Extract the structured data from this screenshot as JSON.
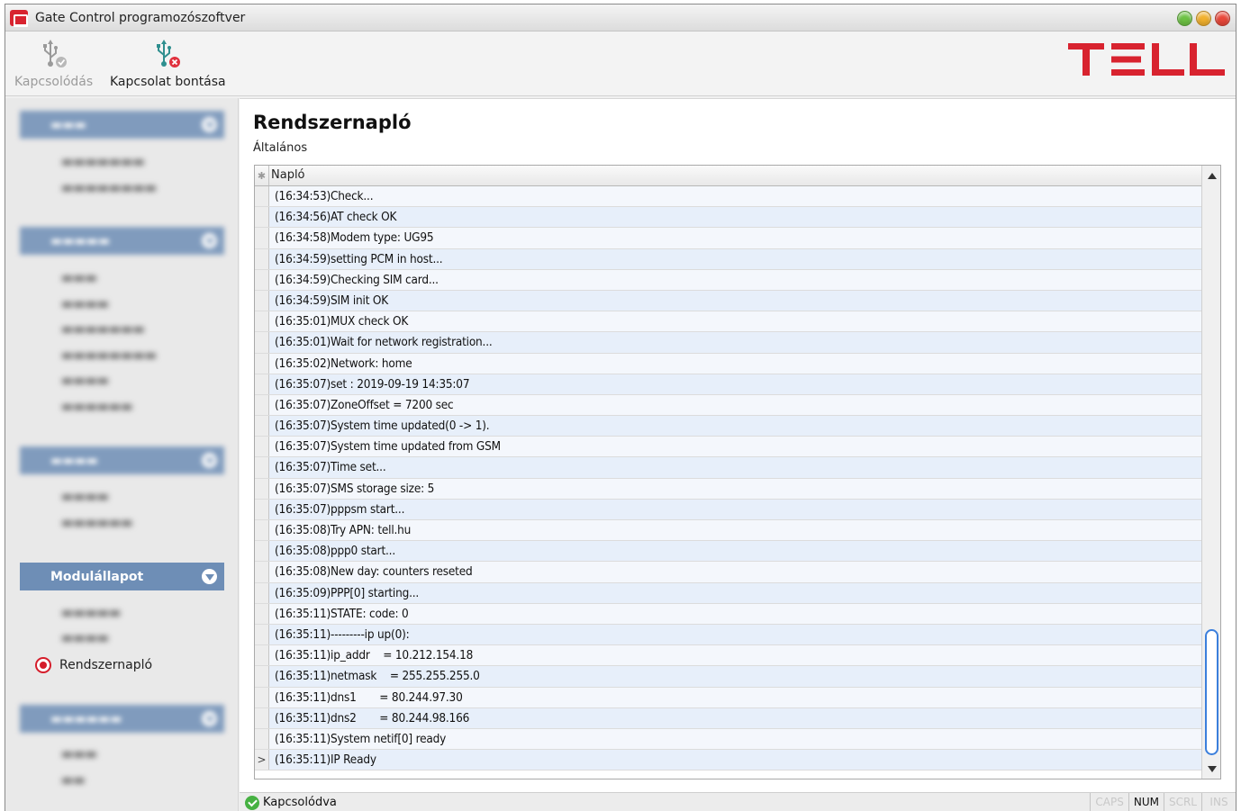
{
  "window": {
    "title": "Gate Control programozószoftver"
  },
  "toolbar": {
    "connect_label": "Kapcsolódás",
    "disconnect_label": "Kapcsolat bontása",
    "logo_text": "TELL",
    "logo_color": "#d8232f"
  },
  "sidebar": {
    "active_group": "Modulállapot",
    "active_item": "Rendszernapló",
    "accent_color": "#6e8eb6"
  },
  "main": {
    "title": "Rendszernapló",
    "section": "Általános",
    "column_header": "Napló",
    "log": [
      "(16:34:53)Check...",
      "(16:34:56)AT check OK",
      "(16:34:58)Modem type: UG95",
      "(16:34:59)setting PCM in host...",
      "(16:34:59)Checking SIM card...",
      "(16:34:59)SIM init OK",
      "(16:35:01)MUX check OK",
      "(16:35:01)Wait for network registration...",
      "(16:35:02)Network: home",
      "(16:35:07)set : 2019-09-19 14:35:07",
      "(16:35:07)ZoneOffset = 7200 sec",
      "(16:35:07)System time updated(0 -> 1).",
      "(16:35:07)System time updated from GSM",
      "(16:35:07)Time set...",
      "(16:35:07)SMS storage size: 5",
      "(16:35:07)pppsm start...",
      "(16:35:08)Try APN: tell.hu",
      "(16:35:08)ppp0 start...",
      "(16:35:08)New day: counters reseted",
      "(16:35:09)PPP[0] starting...",
      "(16:35:11)STATE: code: 0",
      "(16:35:11)---------ip up(0):",
      "(16:35:11)ip_addr    = 10.212.154.18",
      "(16:35:11)netmask    = 255.255.255.0",
      "(16:35:11)dns1       = 80.244.97.30",
      "(16:35:11)dns2       = 80.244.98.166",
      "(16:35:11)System netif[0] ready",
      "(16:35:11)IP Ready"
    ],
    "current_row_marker": ">"
  },
  "statusbar": {
    "status_text": "Kapcsolódva",
    "indicators": [
      "CAPS",
      "NUM",
      "SCRL",
      "INS"
    ]
  }
}
